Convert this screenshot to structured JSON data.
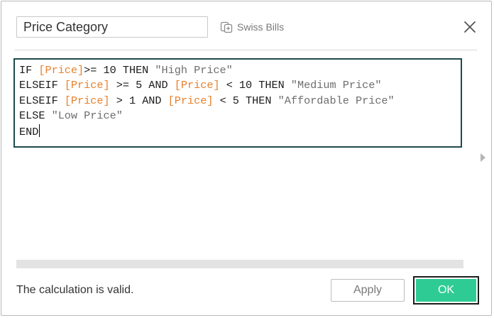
{
  "header": {
    "calc_name": "Price Category",
    "datasource_name": "Swiss Bills",
    "datasource_icon": "datasource-icon",
    "close_icon": "close-icon"
  },
  "editor": {
    "lines": [
      [
        {
          "t": "IF ",
          "c": "kw"
        },
        {
          "t": "[Price]",
          "c": "field"
        },
        {
          "t": ">= 10 THEN ",
          "c": "kw"
        },
        {
          "t": "\"High Price\"",
          "c": "str"
        }
      ],
      [
        {
          "t": "ELSEIF ",
          "c": "kw"
        },
        {
          "t": "[Price]",
          "c": "field"
        },
        {
          "t": " >= 5 AND ",
          "c": "kw"
        },
        {
          "t": "[Price]",
          "c": "field"
        },
        {
          "t": " < 10 THEN ",
          "c": "kw"
        },
        {
          "t": "\"Medium Price\"",
          "c": "str"
        }
      ],
      [
        {
          "t": "ELSEIF ",
          "c": "kw"
        },
        {
          "t": "[Price]",
          "c": "field"
        },
        {
          "t": " > 1 AND ",
          "c": "kw"
        },
        {
          "t": "[Price]",
          "c": "field"
        },
        {
          "t": " < 5 THEN ",
          "c": "kw"
        },
        {
          "t": "\"Affordable Price\"",
          "c": "str"
        }
      ],
      [
        {
          "t": "ELSE ",
          "c": "kw"
        },
        {
          "t": "\"Low Price\"",
          "c": "str"
        }
      ],
      [
        {
          "t": "END",
          "c": "kw"
        }
      ]
    ],
    "colors": {
      "field": "#e8802a",
      "string": "#6d6d6d",
      "keyword": "#1a1a1a",
      "border": "#1e4a4a"
    }
  },
  "footer": {
    "status": "The calculation is valid.",
    "apply_label": "Apply",
    "ok_label": "OK",
    "ok_color": "#2ecc94"
  }
}
